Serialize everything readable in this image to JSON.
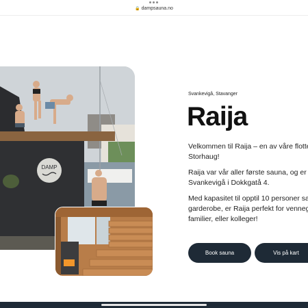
{
  "browser": {
    "url": "dampsauna.no",
    "lock_icon": "lock-icon"
  },
  "hero": {
    "location": "Svankevigå, Stavanger",
    "title": "Raija",
    "paragraph_1_line_1": "Velkommen til Raija – en av våre flotte",
    "paragraph_1_line_2": "Storhaug!",
    "paragraph_2_line_1": "Raija var vår aller første sauna, og er l",
    "paragraph_2_line_2": "Svankevigå i Dokkgatå 4.",
    "paragraph_3_line_1": "Med kapasitet til opptil 10 personer sa",
    "paragraph_3_line_2": "garderobe, er Raija perfekt for venneg",
    "paragraph_3_line_3": "familier, eller kolleger!",
    "book_button": "Book sauna",
    "map_button": "Vis på kart"
  },
  "photos": {
    "sign_text": "DAMP"
  },
  "colors": {
    "button_bg": "#1e2a36",
    "button_text": "#ffffff",
    "bottom_bar": "#1e2a36"
  }
}
